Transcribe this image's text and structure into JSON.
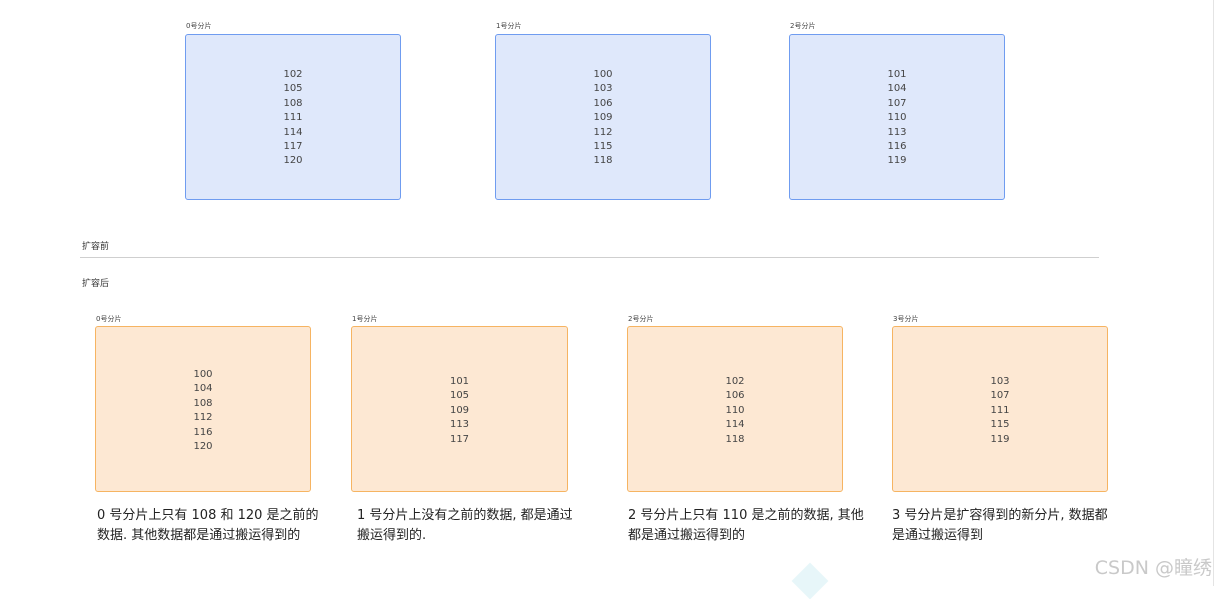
{
  "before": {
    "section_label": "扩容前",
    "shards": [
      {
        "label": "0号分片",
        "values": [
          "102",
          "105",
          "108",
          "111",
          "114",
          "117",
          "120"
        ]
      },
      {
        "label": "1号分片",
        "values": [
          "100",
          "103",
          "106",
          "109",
          "112",
          "115",
          "118"
        ]
      },
      {
        "label": "2号分片",
        "values": [
          "101",
          "104",
          "107",
          "110",
          "113",
          "116",
          "119"
        ]
      }
    ]
  },
  "after": {
    "section_label": "扩容后",
    "shards": [
      {
        "label": "0号分片",
        "values": [
          "100",
          "104",
          "108",
          "112",
          "116",
          "120"
        ],
        "note_line1": "0 号分片上只有 108 和 120 是之前的",
        "note_line2": "数据. 其他数据都是通过搬运得到的"
      },
      {
        "label": "1号分片",
        "values": [
          "101",
          "105",
          "109",
          "113",
          "117"
        ],
        "note_line1": "1 号分片上没有之前的数据, 都是通过",
        "note_line2": "搬运得到的."
      },
      {
        "label": "2号分片",
        "values": [
          "102",
          "106",
          "110",
          "114",
          "118"
        ],
        "note_line1": "2 号分片上只有 110 是之前的数据, 其他",
        "note_line2": "都是通过搬运得到的"
      },
      {
        "label": "3号分片",
        "values": [
          "103",
          "107",
          "111",
          "115",
          "119"
        ],
        "note_line1": "3 号分片是扩容得到的新分片, 数据都",
        "note_line2": "是通过搬运得到"
      }
    ]
  },
  "watermark": "CSDN @瞳绣",
  "colors": {
    "before_fill": "#dfe8fb",
    "before_border": "#6f9cf0",
    "after_fill": "#fde8d3",
    "after_border": "#f6b462"
  }
}
